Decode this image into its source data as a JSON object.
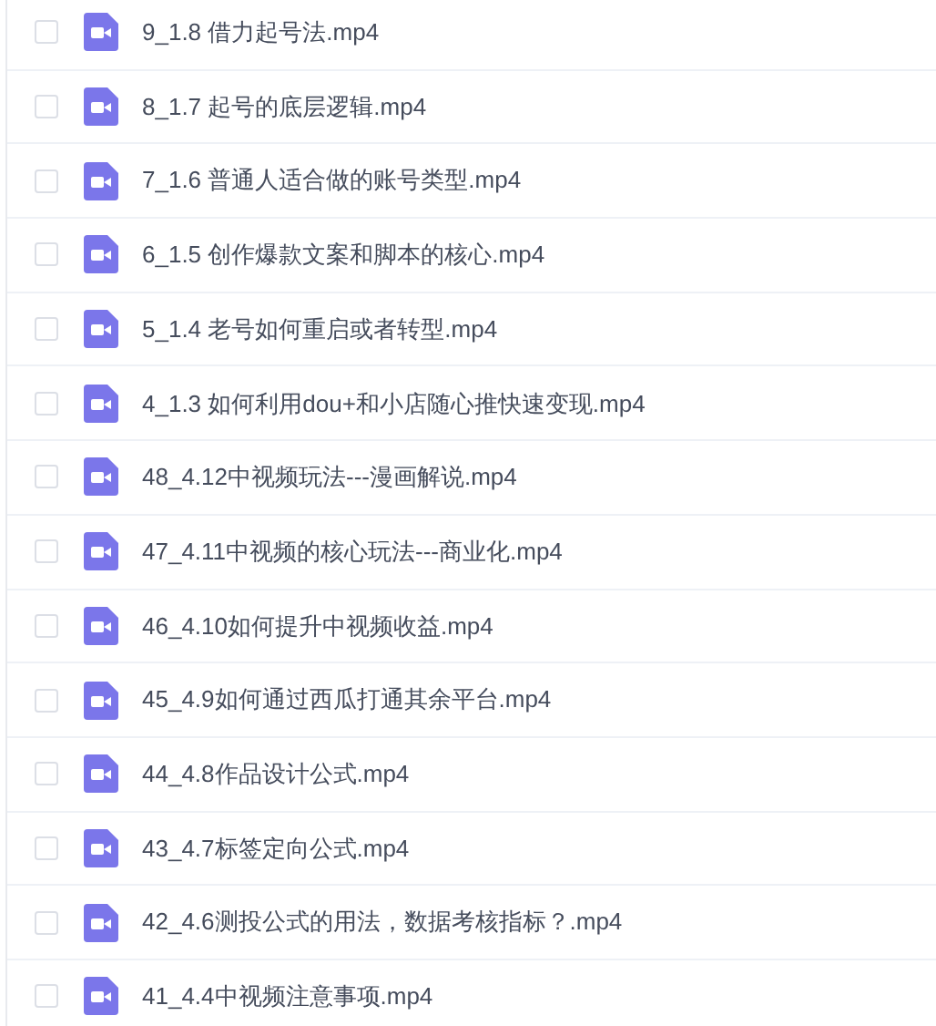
{
  "files": [
    {
      "name": "9_1.8 借力起号法.mp4",
      "checked": false
    },
    {
      "name": "8_1.7 起号的底层逻辑.mp4",
      "checked": false
    },
    {
      "name": "7_1.6 普通人适合做的账号类型.mp4",
      "checked": false
    },
    {
      "name": "6_1.5 创作爆款文案和脚本的核心.mp4",
      "checked": false
    },
    {
      "name": "5_1.4 老号如何重启或者转型.mp4",
      "checked": false
    },
    {
      "name": "4_1.3 如何利用dou+和小店随心推快速变现.mp4",
      "checked": false
    },
    {
      "name": "48_4.12中视频玩法---漫画解说.mp4",
      "checked": false
    },
    {
      "name": "47_4.11中视频的核心玩法---商业化.mp4",
      "checked": false
    },
    {
      "name": "46_4.10如何提升中视频收益.mp4",
      "checked": false
    },
    {
      "name": "45_4.9如何通过西瓜打通其余平台.mp4",
      "checked": false
    },
    {
      "name": "44_4.8作品设计公式.mp4",
      "checked": false
    },
    {
      "name": "43_4.7标签定向公式.mp4",
      "checked": false
    },
    {
      "name": "42_4.6测投公式的用法，数据考核指标？.mp4",
      "checked": false
    },
    {
      "name": "41_4.4中视频注意事项.mp4",
      "checked": false
    }
  ]
}
